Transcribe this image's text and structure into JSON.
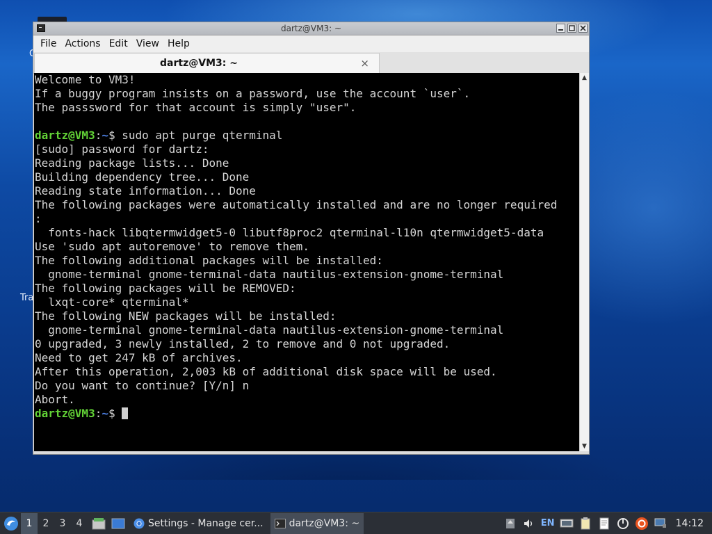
{
  "desktop": {
    "label_partial_1": "C",
    "label_partial_2": "Tra"
  },
  "window": {
    "title": "dartz@VM3: ~",
    "menus": [
      "File",
      "Actions",
      "Edit",
      "View",
      "Help"
    ],
    "tab_title": "dartz@VM3: ~",
    "tab_close": "×"
  },
  "terminal": {
    "lines": [
      "Welcome to VM3!",
      "If a buggy program insists on a password, use the account `user`.",
      "The passsword for that account is simply \"user\".",
      "",
      "",
      "[sudo] password for dartz:",
      "Reading package lists... Done",
      "Building dependency tree... Done",
      "Reading state information... Done",
      "The following packages were automatically installed and are no longer required",
      ":",
      "  fonts-hack libqtermwidget5-0 libutf8proc2 qterminal-l10n qtermwidget5-data",
      "Use 'sudo apt autoremove' to remove them.",
      "The following additional packages will be installed:",
      "  gnome-terminal gnome-terminal-data nautilus-extension-gnome-terminal",
      "The following packages will be REMOVED:",
      "  lxqt-core* qterminal*",
      "The following NEW packages will be installed:",
      "  gnome-terminal gnome-terminal-data nautilus-extension-gnome-terminal",
      "0 upgraded, 3 newly installed, 2 to remove and 0 not upgraded.",
      "Need to get 247 kB of archives.",
      "After this operation, 2,003 kB of additional disk space will be used.",
      "Do you want to continue? [Y/n] n",
      "Abort."
    ],
    "prompt_user": "dartz@VM3",
    "prompt_sep": ":",
    "prompt_path": "~",
    "prompt_dollar": "$ ",
    "command_1": "sudo apt purge qterminal",
    "prompt_line_index_1": 4,
    "colors": {
      "user": "#62d236",
      "path": "#4c7fe0",
      "text": "#d6d6d6",
      "background": "#000000"
    }
  },
  "taskbar": {
    "workspaces": [
      "1",
      "2",
      "3",
      "4"
    ],
    "active_workspace": "1",
    "tasks": [
      {
        "label": "Settings - Manage cer...",
        "icon": "chromium-icon"
      },
      {
        "label": "dartz@VM3: ~",
        "icon": "terminal-icon"
      }
    ],
    "language": "EN",
    "clock": "14:12"
  }
}
